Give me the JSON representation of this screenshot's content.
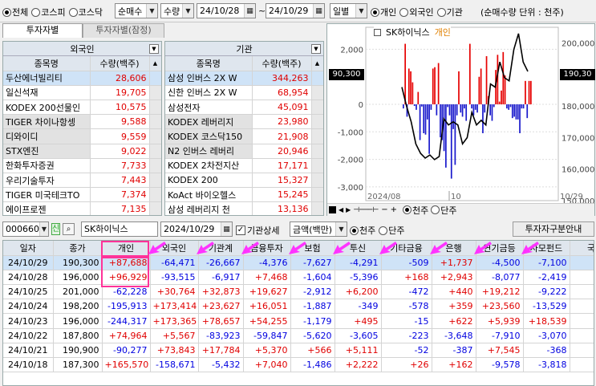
{
  "toolbar": {
    "market_radios": [
      {
        "label": "전체",
        "on": true
      },
      {
        "label": "코스피",
        "on": false
      },
      {
        "label": "코스닥",
        "on": false
      }
    ],
    "sort_select": "순매수",
    "unit_select": "수량",
    "date_from": "24/10/28",
    "date_to": "24/10/29",
    "period_select": "일별",
    "investor_radios": [
      {
        "label": "개인",
        "on": true
      },
      {
        "label": "외국인",
        "on": false
      },
      {
        "label": "기관",
        "on": false
      }
    ],
    "unit_note": "(순매수량 단위 : 천주)"
  },
  "tabs": [
    {
      "label": "투자자별",
      "active": true
    },
    {
      "label": "투자자별(잠정)",
      "active": false
    }
  ],
  "foreign_panel": {
    "title": "외국인",
    "col_name": "종목명",
    "col_qty": "수량(백주)",
    "rows": [
      {
        "name": "두산에너빌리티",
        "qty": "28,606",
        "sel": true
      },
      {
        "name": "일신석재",
        "qty": "19,705"
      },
      {
        "name": "KODEX 200선물인",
        "qty": "10,575"
      },
      {
        "name": "TIGER 차이나항셍",
        "qty": "9,588",
        "gray": true
      },
      {
        "name": "디와이디",
        "qty": "9,559",
        "gray": true
      },
      {
        "name": "STX엔진",
        "qty": "9,022",
        "gray": true
      },
      {
        "name": "한화투자증권",
        "qty": "7,733"
      },
      {
        "name": "우리기술투자",
        "qty": "7,443"
      },
      {
        "name": "TIGER 미국테크TO",
        "qty": "7,374"
      },
      {
        "name": "에이프로젠",
        "qty": "7,135"
      }
    ]
  },
  "inst_panel": {
    "title": "기관",
    "col_name": "종목명",
    "col_qty": "수량(백주)",
    "rows": [
      {
        "name": "삼성 인버스 2X W",
        "qty": "344,263",
        "sel": true
      },
      {
        "name": "신한 인버스 2X W",
        "qty": "68,954",
        "mark": true
      },
      {
        "name": "삼성전자",
        "qty": "45,091",
        "mark": true
      },
      {
        "name": "KODEX 레버리지",
        "qty": "23,980",
        "gray": true,
        "mark": true
      },
      {
        "name": "KODEX 코스닥150",
        "qty": "21,908",
        "gray": true
      },
      {
        "name": "N2 인버스 레버리",
        "qty": "20,946",
        "gray": true
      },
      {
        "name": "KODEX 2차전지산",
        "qty": "17,171"
      },
      {
        "name": "KODEX 200",
        "qty": "15,327"
      },
      {
        "name": "KoAct 바이오헬스",
        "qty": "15,245"
      },
      {
        "name": "삼성 레버리지 천",
        "qty": "13,136"
      }
    ]
  },
  "chart": {
    "stock_name": "SK하이닉스",
    "investor_name": "개인",
    "left_ticks": [
      "2,000",
      "0",
      "-1,000",
      "-2,000",
      "-3,000"
    ],
    "right_ticks": [
      "200,000",
      "190,000",
      "180,000",
      "170,000",
      "160,000",
      "150,000"
    ],
    "left_value_box": "90,300",
    "right_value_box": "190,30",
    "x_labels": [
      "2024/08",
      "10",
      "10/29"
    ],
    "radio_qty": "천주",
    "radio_price": "단주",
    "radio_qty_on": true,
    "radio_price_on": false
  },
  "chart_data": {
    "type": "bar",
    "series": [
      {
        "name": "개인",
        "values": [
          -150,
          2200,
          -450,
          1300,
          1200,
          800,
          -60,
          -200,
          450,
          -1300,
          -80,
          -1050,
          -1100,
          -550,
          -1800,
          -200,
          1300,
          1350,
          -400,
          1500,
          -1200,
          -1300,
          -1700,
          -2300,
          -100,
          -400,
          -2700,
          -900,
          -2200,
          -400,
          1200,
          -300,
          -450,
          -150,
          -600,
          0,
          2200,
          -150,
          -400,
          -200,
          -300,
          1000,
          1300,
          -1050,
          -300,
          1750,
          300,
          -400,
          -600,
          -100,
          1250,
          1800,
          100,
          500,
          1900,
          1050,
          -150,
          -200,
          -100,
          -500,
          -450,
          -550,
          -550,
          -1050,
          -150,
          -150,
          850,
          -500,
          850,
          850
        ]
      },
      {
        "name": "종가",
        "values": [
          186000,
          180000,
          175000,
          168000,
          165000,
          163500,
          164500,
          163000,
          164000,
          176000,
          174000,
          175000,
          174000,
          168000,
          170000,
          178000,
          174000,
          175500,
          174000,
          187000,
          186000,
          194000,
          189000,
          188000,
          198000,
          203000,
          194000,
          191000
        ]
      }
    ],
    "ylim_left": [
      -3500,
      2800
    ],
    "ylim_right": [
      150000,
      205000
    ],
    "x_tick_labels": [
      "2024/08",
      "10",
      "10/29"
    ]
  },
  "stock_bar": {
    "code": "000660",
    "badge": "신",
    "name": "SK하이닉스",
    "date": "2024/10/29",
    "detail_label": "기관상세",
    "detail_checked": true,
    "amount_select": "금액(백만)",
    "unit_radios": [
      {
        "label": "천주",
        "on": true
      },
      {
        "label": "단주",
        "on": false
      }
    ],
    "guide_button": "투자자구분안내"
  },
  "main_table": {
    "headers": [
      "일자",
      "종가",
      "개인",
      "외국인",
      "기관계",
      "금융투자",
      "보험",
      "투신",
      "기타금융",
      "은행",
      "연기금등",
      "사모펀드",
      "국"
    ],
    "rows": [
      {
        "sel": true,
        "cells": [
          "24/10/29",
          "190,300",
          "+87,688",
          "-64,471",
          "-26,667",
          "-4,376",
          "-7,627",
          "-4,291",
          "-509",
          "+1,737",
          "-4,500",
          "-7,100",
          ""
        ]
      },
      {
        "cells": [
          "24/10/28",
          "196,000",
          "+96,929",
          "-93,515",
          "-6,917",
          "+7,468",
          "-1,604",
          "-5,396",
          "+168",
          "+2,943",
          "-8,077",
          "-2,419",
          ""
        ]
      },
      {
        "cells": [
          "24/10/25",
          "201,000",
          "-62,228",
          "+30,764",
          "+32,873",
          "+19,627",
          "-2,912",
          "+6,200",
          "-472",
          "+440",
          "+19,212",
          "-9,222",
          ""
        ]
      },
      {
        "cells": [
          "24/10/24",
          "198,200",
          "-195,913",
          "+173,414",
          "+23,627",
          "+16,051",
          "-1,887",
          "-349",
          "-578",
          "+359",
          "+23,560",
          "-13,529",
          ""
        ]
      },
      {
        "cells": [
          "24/10/23",
          "196,000",
          "-244,317",
          "+173,365",
          "+78,657",
          "+54,255",
          "-1,179",
          "+495",
          "-15",
          "+622",
          "+5,939",
          "+18,539",
          ""
        ]
      },
      {
        "cells": [
          "24/10/22",
          "187,800",
          "+74,964",
          "+5,567",
          "-83,923",
          "-59,847",
          "-5,620",
          "-3,605",
          "-223",
          "-3,648",
          "-7,910",
          "-3,070",
          ""
        ]
      },
      {
        "cells": [
          "24/10/21",
          "190,900",
          "-90,277",
          "+73,843",
          "+17,784",
          "+5,370",
          "+566",
          "+5,111",
          "-52",
          "-387",
          "+7,545",
          "-368",
          ""
        ]
      },
      {
        "cells": [
          "24/10/18",
          "187,300",
          "+165,570",
          "-158,671",
          "-5,432",
          "+7,040",
          "-1,486",
          "+2,222",
          "+26",
          "+162",
          "-9,578",
          "-3,818",
          ""
        ]
      }
    ]
  },
  "colors": {
    "positive": "#e00000",
    "negative": "#0000e0",
    "highlight": "#ff3399",
    "arrow": "#ff33ff",
    "selected_row": "#cfe3f7",
    "header_bg": "#dfe6ee"
  }
}
